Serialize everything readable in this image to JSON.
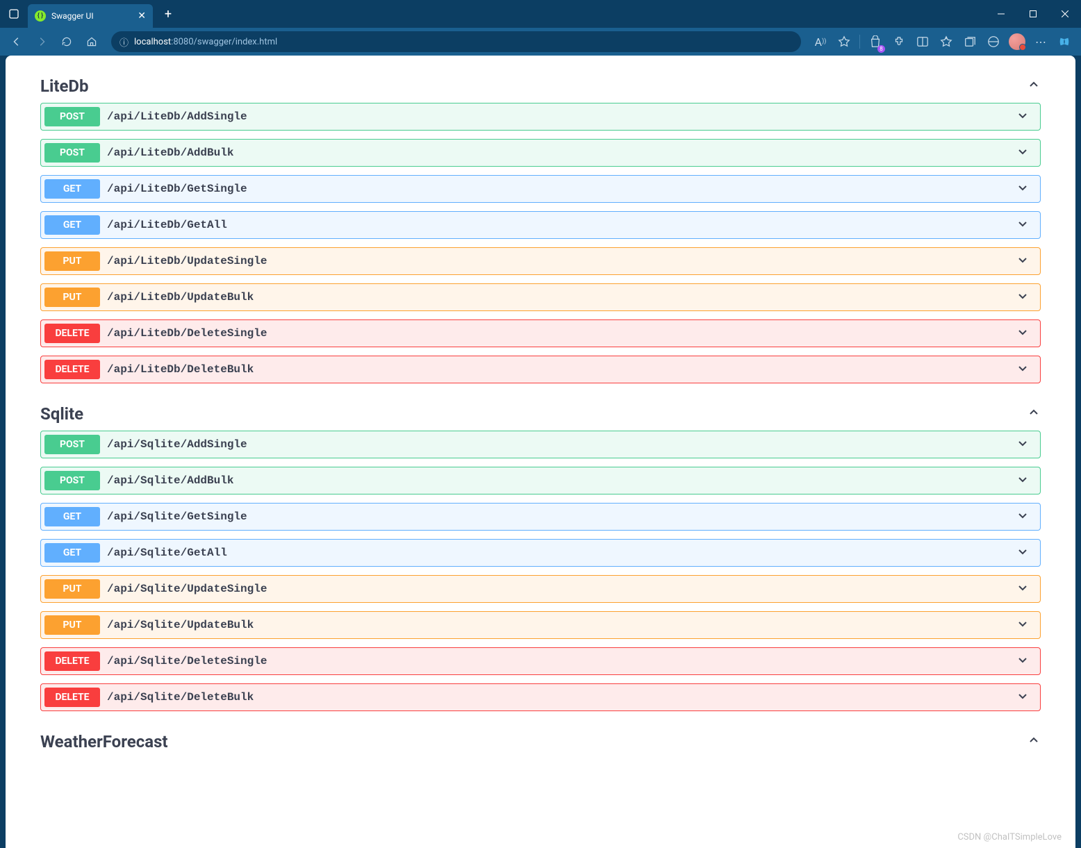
{
  "browser": {
    "tab_title": "Swagger UI",
    "url_host": "localhost",
    "url_port": ":8080",
    "url_path": "/swagger/index.html",
    "badge_count": "8"
  },
  "tags": [
    {
      "name": "LiteDb",
      "operations": [
        {
          "method": "POST",
          "path": "/api/LiteDb/AddSingle"
        },
        {
          "method": "POST",
          "path": "/api/LiteDb/AddBulk"
        },
        {
          "method": "GET",
          "path": "/api/LiteDb/GetSingle"
        },
        {
          "method": "GET",
          "path": "/api/LiteDb/GetAll"
        },
        {
          "method": "PUT",
          "path": "/api/LiteDb/UpdateSingle"
        },
        {
          "method": "PUT",
          "path": "/api/LiteDb/UpdateBulk"
        },
        {
          "method": "DELETE",
          "path": "/api/LiteDb/DeleteSingle"
        },
        {
          "method": "DELETE",
          "path": "/api/LiteDb/DeleteBulk"
        }
      ]
    },
    {
      "name": "Sqlite",
      "operations": [
        {
          "method": "POST",
          "path": "/api/Sqlite/AddSingle"
        },
        {
          "method": "POST",
          "path": "/api/Sqlite/AddBulk"
        },
        {
          "method": "GET",
          "path": "/api/Sqlite/GetSingle"
        },
        {
          "method": "GET",
          "path": "/api/Sqlite/GetAll"
        },
        {
          "method": "PUT",
          "path": "/api/Sqlite/UpdateSingle"
        },
        {
          "method": "PUT",
          "path": "/api/Sqlite/UpdateBulk"
        },
        {
          "method": "DELETE",
          "path": "/api/Sqlite/DeleteSingle"
        },
        {
          "method": "DELETE",
          "path": "/api/Sqlite/DeleteBulk"
        }
      ]
    },
    {
      "name": "WeatherForecast",
      "operations": []
    }
  ],
  "watermark": "CSDN @ChaITSimpleLove"
}
